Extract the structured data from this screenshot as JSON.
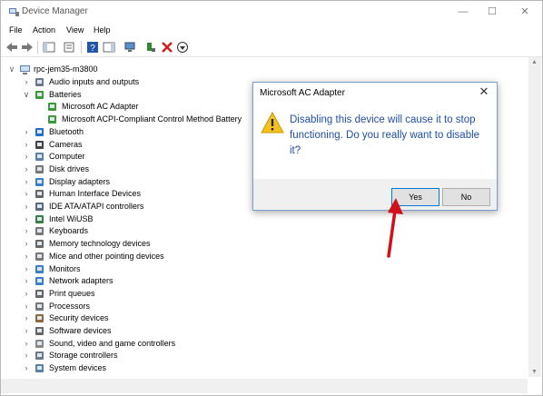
{
  "window": {
    "title": "Device Manager"
  },
  "menu": [
    "File",
    "Action",
    "View",
    "Help"
  ],
  "tree": {
    "root": "rpc-jem35-m3800",
    "items": [
      {
        "label": "Audio inputs and outputs",
        "level": 1,
        "expander": "collapsed",
        "icon": "speaker-icon"
      },
      {
        "label": "Batteries",
        "level": 1,
        "expander": "expanded",
        "icon": "battery-icon"
      },
      {
        "label": "Microsoft AC Adapter",
        "level": 2,
        "expander": "none",
        "icon": "battery-icon"
      },
      {
        "label": "Microsoft ACPI-Compliant Control Method Battery",
        "level": 2,
        "expander": "none",
        "icon": "battery-icon"
      },
      {
        "label": "Bluetooth",
        "level": 1,
        "expander": "collapsed",
        "icon": "bluetooth-icon"
      },
      {
        "label": "Cameras",
        "level": 1,
        "expander": "collapsed",
        "icon": "camera-icon"
      },
      {
        "label": "Computer",
        "level": 1,
        "expander": "collapsed",
        "icon": "computer-icon"
      },
      {
        "label": "Disk drives",
        "level": 1,
        "expander": "collapsed",
        "icon": "disk-icon"
      },
      {
        "label": "Display adapters",
        "level": 1,
        "expander": "collapsed",
        "icon": "display-icon"
      },
      {
        "label": "Human Interface Devices",
        "level": 1,
        "expander": "collapsed",
        "icon": "hid-icon"
      },
      {
        "label": "IDE ATA/ATAPI controllers",
        "level": 1,
        "expander": "collapsed",
        "icon": "ide-icon"
      },
      {
        "label": "Intel WiUSB",
        "level": 1,
        "expander": "collapsed",
        "icon": "usb-icon"
      },
      {
        "label": "Keyboards",
        "level": 1,
        "expander": "collapsed",
        "icon": "keyboard-icon"
      },
      {
        "label": "Memory technology devices",
        "level": 1,
        "expander": "collapsed",
        "icon": "memory-icon"
      },
      {
        "label": "Mice and other pointing devices",
        "level": 1,
        "expander": "collapsed",
        "icon": "mouse-icon"
      },
      {
        "label": "Monitors",
        "level": 1,
        "expander": "collapsed",
        "icon": "monitor-icon"
      },
      {
        "label": "Network adapters",
        "level": 1,
        "expander": "collapsed",
        "icon": "network-icon"
      },
      {
        "label": "Print queues",
        "level": 1,
        "expander": "collapsed",
        "icon": "printer-icon"
      },
      {
        "label": "Processors",
        "level": 1,
        "expander": "collapsed",
        "icon": "processor-icon"
      },
      {
        "label": "Security devices",
        "level": 1,
        "expander": "collapsed",
        "icon": "security-icon"
      },
      {
        "label": "Software devices",
        "level": 1,
        "expander": "collapsed",
        "icon": "software-icon"
      },
      {
        "label": "Sound, video and game controllers",
        "level": 1,
        "expander": "collapsed",
        "icon": "sound-icon"
      },
      {
        "label": "Storage controllers",
        "level": 1,
        "expander": "collapsed",
        "icon": "storage-icon"
      },
      {
        "label": "System devices",
        "level": 1,
        "expander": "collapsed",
        "icon": "system-icon"
      }
    ]
  },
  "dialog": {
    "title": "Microsoft AC Adapter",
    "message": "Disabling this device will cause it to stop functioning. Do you really want to disable it?",
    "yes_label": "Yes",
    "no_label": "No"
  },
  "colors": {
    "accent": "#0078d7",
    "dialog_text": "#1f4fa3",
    "annotation_arrow": "#d0101a"
  }
}
